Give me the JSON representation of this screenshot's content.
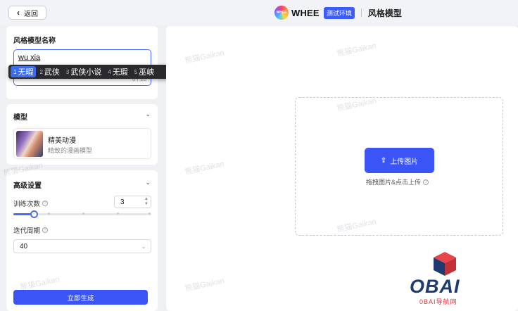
{
  "header": {
    "back_label": "返回",
    "brand_logo_text": "WHEE",
    "brand_name": "WHEE",
    "env_badge": "测试环境",
    "page_title": "风格模型"
  },
  "name_section": {
    "title": "风格模型名称",
    "input_value": "wu xia",
    "char_count": "0 / 20"
  },
  "ime": {
    "candidates": [
      {
        "num": "1",
        "text": "无暇"
      },
      {
        "num": "2",
        "text": "武侠"
      },
      {
        "num": "3",
        "text": "武侠小说"
      },
      {
        "num": "4",
        "text": "无瑕"
      },
      {
        "num": "5",
        "text": "巫峡"
      }
    ],
    "selected_index": 0
  },
  "model_section": {
    "title": "模型",
    "item_name": "精美动漫",
    "item_desc": "精致的漫画模型"
  },
  "advanced_section": {
    "title": "高级设置",
    "train_count_label": "训练次数",
    "train_count_value": "3",
    "train_count_fraction": 0.15,
    "epoch_label": "迭代周期",
    "epoch_value": "40",
    "generate_label": "立即生成"
  },
  "upload": {
    "button_label": "上传图片",
    "hint": "拖拽图片&点击上传"
  },
  "watermark_text": "熊猫Gaikan",
  "corner_logo": {
    "word": "OBAI",
    "sub": "0BAI导航网"
  },
  "colors": {
    "accent": "#3b54f5",
    "ime_selected": "#3b6cf0",
    "page_bg": "#eef0f4"
  }
}
